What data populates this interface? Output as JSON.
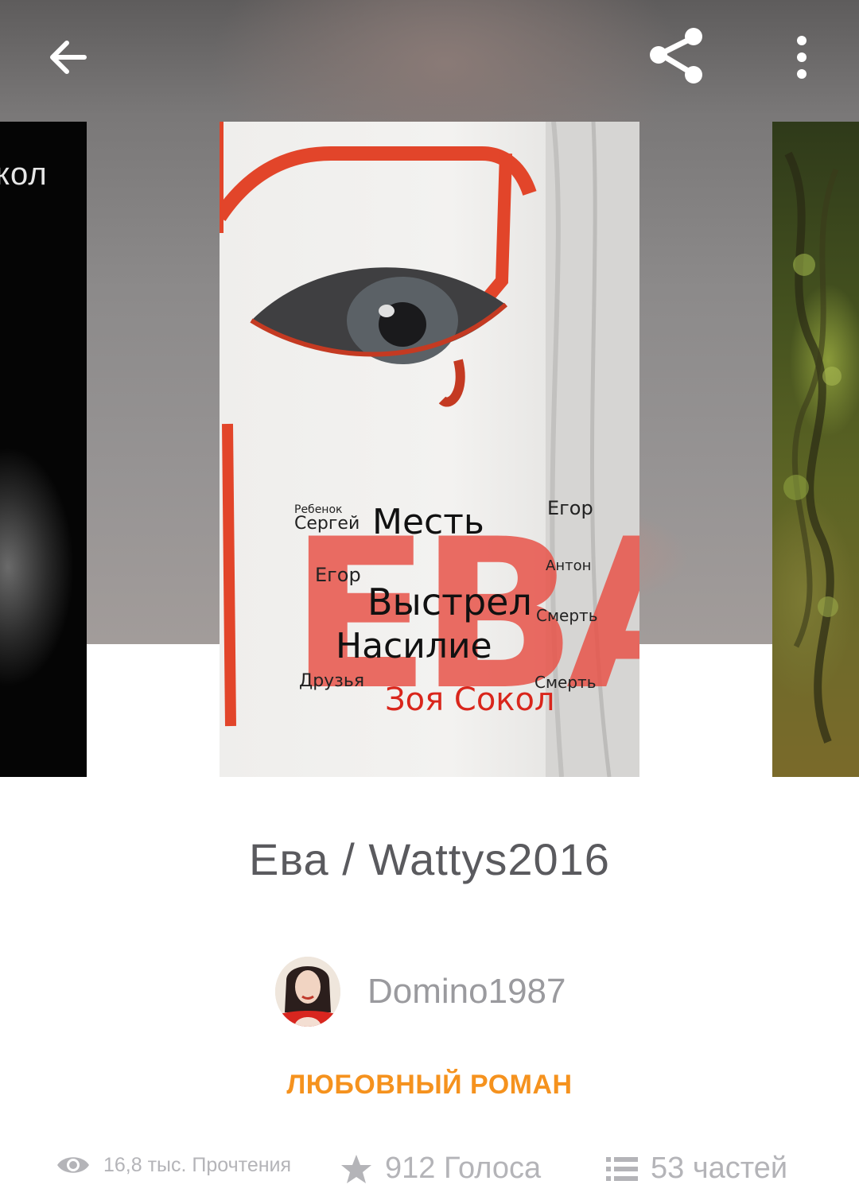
{
  "story": {
    "title": "Ева / Wattys2016",
    "author": "Domino1987",
    "genre": "ЛЮБОВНЫЙ РОМАН",
    "cover_main": {
      "words": [
        "Ребенок",
        "Сергей",
        "Месть",
        "Егор",
        "Друзья",
        "Егор",
        "Антон",
        "Выстрел",
        "Смерть",
        "Насилие",
        "Друзья",
        "Смерть"
      ],
      "big_word": "ЕВА",
      "author_line": "Зоя Сокол"
    },
    "cover_left_fragment": "кол"
  },
  "stats": {
    "reads": "16,8 тыс. Прочтения",
    "votes": "912 Голоса",
    "parts": "53 частей"
  },
  "icons": {
    "back": "arrow-left-icon",
    "share": "share-icon",
    "more": "more-vert-icon",
    "reads": "eye-icon",
    "votes": "star-icon",
    "parts": "list-icon"
  },
  "colors": {
    "accent": "#f5921e",
    "title_text": "#5a5a5e",
    "muted": "#b4b4b8"
  }
}
